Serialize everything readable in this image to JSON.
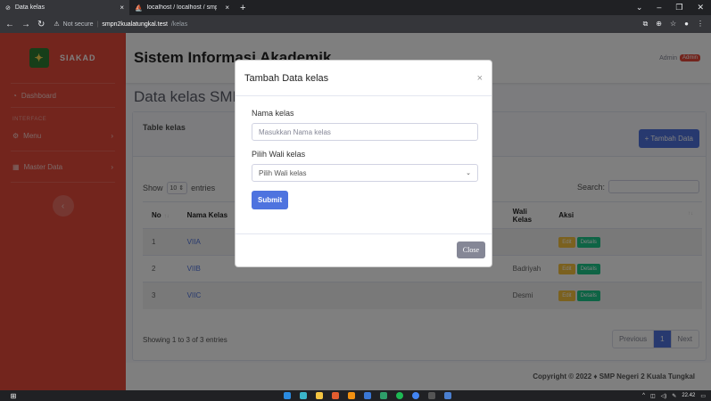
{
  "browser": {
    "tabs": [
      {
        "label": "Data kelas",
        "active": true
      },
      {
        "label": "localhost / localhost / smp2kuala",
        "active": false
      }
    ],
    "new_tab": "+",
    "address": {
      "not_secure": "Not secure",
      "host": "smpn2kualatungkal.test",
      "path": "/kelas"
    }
  },
  "sidebar": {
    "brand": "SIAKAD",
    "items": [
      {
        "label": "Dashboard",
        "icon": "dashboard-icon"
      }
    ],
    "heading": "INTERFACE",
    "menus": [
      {
        "label": "Menu",
        "icon": "gear-icon"
      },
      {
        "label": "Master Data",
        "icon": "table-icon"
      }
    ]
  },
  "topbar": {
    "title": "Sistem Informasi Akademik",
    "user": "Admin",
    "role_badge": "Admin"
  },
  "page": {
    "heading": "Data kelas SMPN 2"
  },
  "card": {
    "title": "Table kelas",
    "add_button": "+ Tambah Data"
  },
  "table_controls": {
    "show": "Show",
    "entries_value": "10",
    "entries": "entries",
    "search": "Search:"
  },
  "table": {
    "headers": [
      "No",
      "Nama Kelas",
      "Wali Kelas",
      "Aksi"
    ],
    "rows": [
      {
        "no": "1",
        "nama": "VIIA",
        "wali": ""
      },
      {
        "no": "2",
        "nama": "VIIB",
        "wali": "Badriyah"
      },
      {
        "no": "3",
        "nama": "VIIC",
        "wali": "Desmi"
      }
    ],
    "edit_label": "Edit",
    "details_label": "Details"
  },
  "pagination": {
    "info": "Showing 1 to 3 of 3 entries",
    "previous": "Previous",
    "current": "1",
    "next": "Next"
  },
  "footer": {
    "copyright": "Copyright © 2022 ♦ SMP Negeri 2 Kuala Tungkal"
  },
  "modal": {
    "title": "Tambah Data kelas",
    "close_x": "×",
    "field1_label": "Nama kelas",
    "field1_placeholder": "Masukkan Nama kelas",
    "field2_label": "Pilih Wali kelas",
    "field2_value": "Pilih Wali kelas",
    "submit": "Submit",
    "close": "Close"
  },
  "taskbar": {
    "time": "22.42"
  },
  "colors": {
    "sidebar": "#e74a3b",
    "primary": "#4e73df",
    "warning": "#f6c23e",
    "success": "#1cc88a"
  }
}
